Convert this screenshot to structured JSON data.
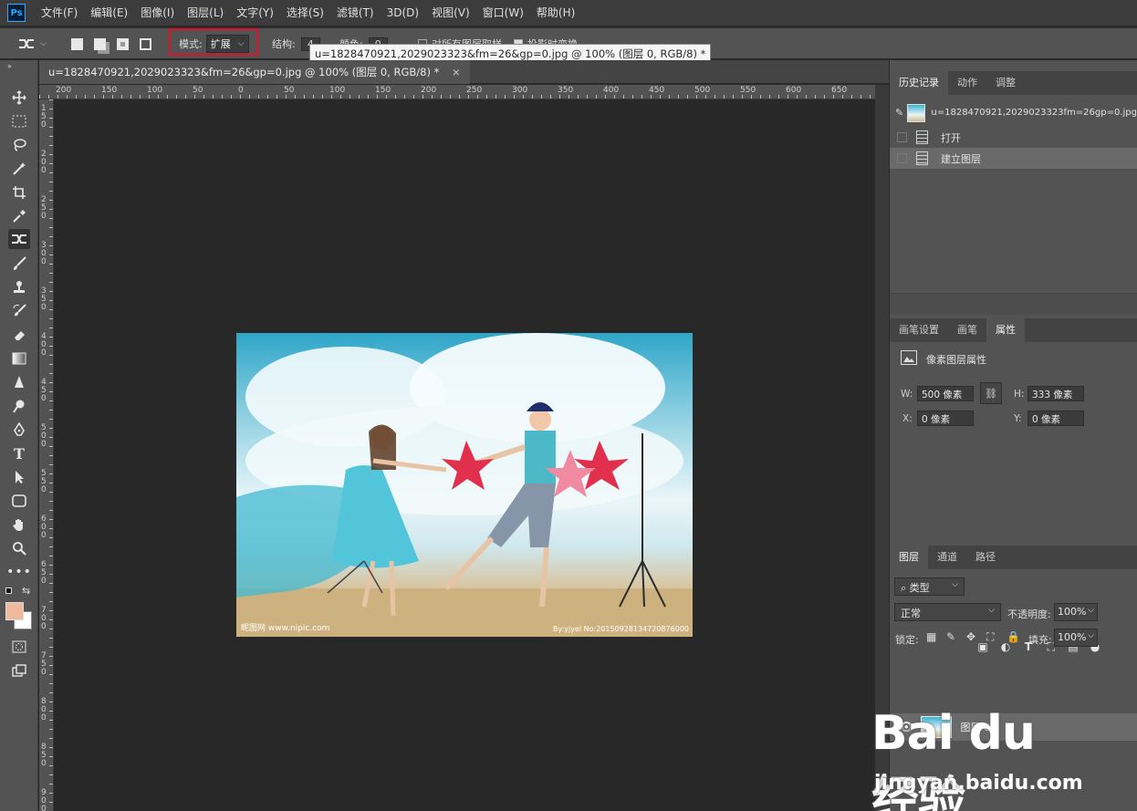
{
  "app": {
    "logo": "Ps"
  },
  "menu": [
    "文件(F)",
    "编辑(E)",
    "图像(I)",
    "图层(L)",
    "文字(Y)",
    "选择(S)",
    "滤镜(T)",
    "3D(D)",
    "视图(V)",
    "窗口(W)",
    "帮助(H)"
  ],
  "options": {
    "mode_label": "模式:",
    "mode_value": "扩展",
    "structure_label": "结构:",
    "structure_value": "4",
    "color_label": "颜色:",
    "color_value": "0",
    "sample_all_label": "对所有图层取样",
    "transform_label": "投影时变换",
    "tooltip": "u=1828470921,2029023323&fm=26&gp=0.jpg @ 100% (图层 0, RGB/8) *"
  },
  "document": {
    "tab_title": "u=1828470921,2029023323&fm=26&gp=0.jpg @ 100% (图层 0, RGB/8) *",
    "ruler_top": [
      "200",
      "150",
      "100",
      "50",
      "0",
      "50",
      "100",
      "150",
      "200",
      "250",
      "300",
      "350",
      "400",
      "450",
      "500",
      "550",
      "600",
      "650"
    ],
    "ruler_left": [
      "150",
      "200",
      "250",
      "300",
      "350",
      "400",
      "450",
      "500",
      "550",
      "600",
      "650",
      "700",
      "750",
      "800",
      "850",
      "900"
    ],
    "watermark_left": "昵图网 www.nipic.com",
    "watermark_right": "By:yjyel No:20150928134720876000"
  },
  "history_panel": {
    "tabs": [
      "历史记录",
      "动作",
      "调整"
    ],
    "snapshot": "u=1828470921,2029023323fm=26gp=0.jpg",
    "items": [
      "打开",
      "建立图层"
    ]
  },
  "properties_panel": {
    "tabs": [
      "画笔设置",
      "画笔",
      "属性"
    ],
    "title": "像素图层属性",
    "w_label": "W:",
    "w_value": "500 像素",
    "h_label": "H:",
    "h_value": "333 像素",
    "x_label": "X:",
    "x_value": "0 像素",
    "y_label": "Y:",
    "y_value": "0 像素"
  },
  "layers_panel": {
    "tabs": [
      "图层",
      "通道",
      "路径"
    ],
    "filter": "类型",
    "blend_mode": "正常",
    "opacity_label": "不透明度:",
    "opacity_value": "100%",
    "lock_label": "锁定:",
    "fill_label": "填充:",
    "fill_value": "100%",
    "layer_name": "图层 0"
  },
  "watermark": {
    "brand": "Bai du 经验",
    "url": "jingyan.baidu.com"
  },
  "colors": {
    "foreground": "#f0b89c",
    "background": "#ffffff",
    "highlight": "#e0102a"
  }
}
